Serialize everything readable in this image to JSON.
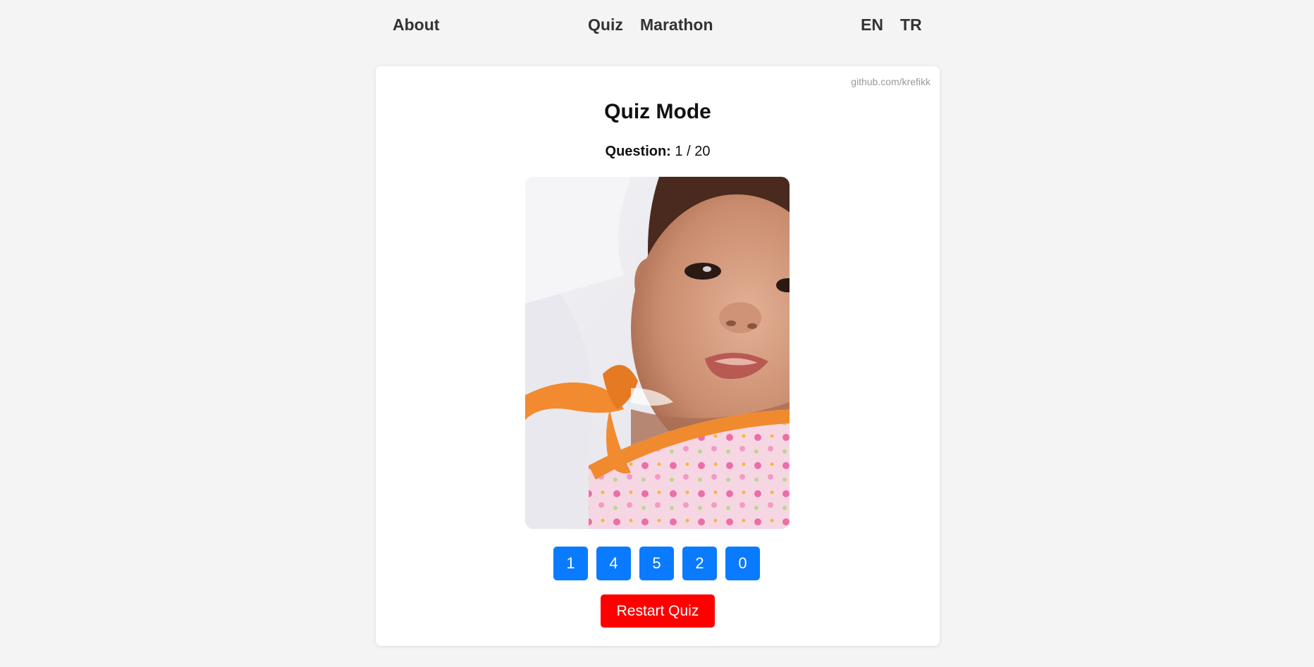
{
  "nav": {
    "about": "About",
    "quiz": "Quiz",
    "marathon": "Marathon",
    "lang_en": "EN",
    "lang_tr": "TR"
  },
  "card": {
    "github": "github.com/krefikk",
    "title": "Quiz Mode",
    "question_label": "Question:",
    "question_progress": "1 / 20",
    "photo_icon": "baby-photo",
    "answers": [
      "1",
      "4",
      "5",
      "2",
      "0"
    ],
    "restart_label": "Restart Quiz"
  },
  "colors": {
    "background": "#f4f4f4",
    "card": "#ffffff",
    "answer_button": "#0a7bff",
    "restart_button": "#ff0000",
    "nav_text": "#333333",
    "github_text": "#9a9a9a"
  }
}
